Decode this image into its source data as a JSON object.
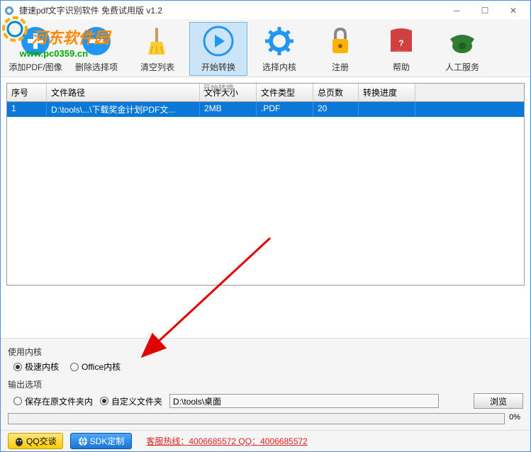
{
  "window": {
    "title": "捷速pdf文字识别软件 免费试用版 v1.2"
  },
  "watermark": {
    "text": "河东软件园",
    "url": "www.pc0359.cn"
  },
  "toolbar": {
    "add": "添加PDF/图像",
    "delete": "删除选择项",
    "clear": "清空列表",
    "start": "开始转换",
    "start_sub": "开始转换",
    "core": "选择内核",
    "register": "注册",
    "help": "帮助",
    "service": "人工服务"
  },
  "table": {
    "headers": {
      "seq": "序号",
      "path": "文件路径",
      "size": "文件大小",
      "type": "文件类型",
      "pages": "总页数",
      "progress": "转换进度"
    },
    "row": {
      "seq": "1",
      "path": "D:\\tools\\...\\下载奖金计划PDF文...",
      "size": "2MB",
      "type": ".PDF",
      "pages": "20",
      "progress": ""
    }
  },
  "kernel": {
    "label": "使用内核",
    "fast": "极速内核",
    "office": "Office内核"
  },
  "output": {
    "label": "输出选项",
    "keep": "保存在原文件夹内",
    "custom": "自定义文件夹",
    "path": "D:\\tools\\桌面",
    "browse": "浏览"
  },
  "progress": {
    "percent": "0%"
  },
  "footer": {
    "qq": "QQ交谈",
    "sdk": "SDK定制",
    "hotline": "客服热线：4006685572 QQ：4006685572"
  }
}
